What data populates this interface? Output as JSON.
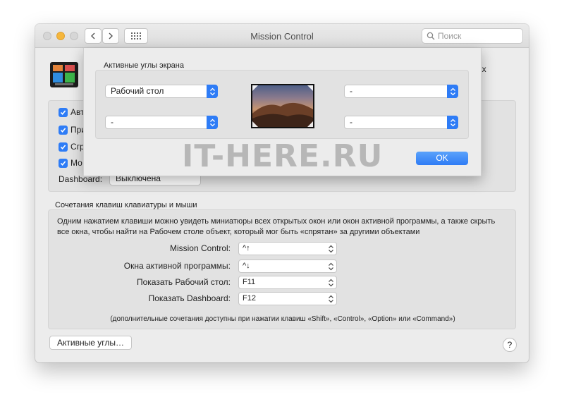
{
  "window": {
    "title": "Mission Control",
    "search_placeholder": "Поиск"
  },
  "header": {
    "cut_text": "ых"
  },
  "options": {
    "checkboxes": [
      {
        "label": "Авт",
        "checked": true
      },
      {
        "label": "При",
        "checked": true
      },
      {
        "label": "Сгр",
        "checked": true
      },
      {
        "label": "Мо",
        "checked": true
      }
    ],
    "dashboard_label": "Dashboard:",
    "dashboard_value": "Выключена"
  },
  "shortcuts": {
    "title": "Сочетания клавиш клавиатуры и мыши",
    "description": "Одним нажатием клавиши можно увидеть миниатюры всех открытых окон или окон активной программы, а также скрыть все окна, чтобы найти на Рабочем столе объект, который мог быть «спрятан» за другими объектами",
    "rows": [
      {
        "label": "Mission Control:",
        "value": "^↑"
      },
      {
        "label": "Окна активной программы:",
        "value": "^↓"
      },
      {
        "label": "Показать Рабочий стол:",
        "value": "F11"
      },
      {
        "label": "Показать Dashboard:",
        "value": "F12"
      }
    ],
    "footnote": "(дополнительные сочетания доступны при нажатии клавиш «Shift», «Control», «Option» или «Command»)"
  },
  "buttons": {
    "hot_corners": "Активные углы…",
    "help": "?"
  },
  "sheet": {
    "title": "Активные углы экрана",
    "top_left": "Рабочий стол",
    "bottom_left": "-",
    "top_right": "-",
    "bottom_right": "-",
    "ok": "OK"
  },
  "watermark": "IT-HERE.RU",
  "colors": {
    "accent": "#2e7cf6",
    "traffic_yellow": "#f6b73c"
  }
}
